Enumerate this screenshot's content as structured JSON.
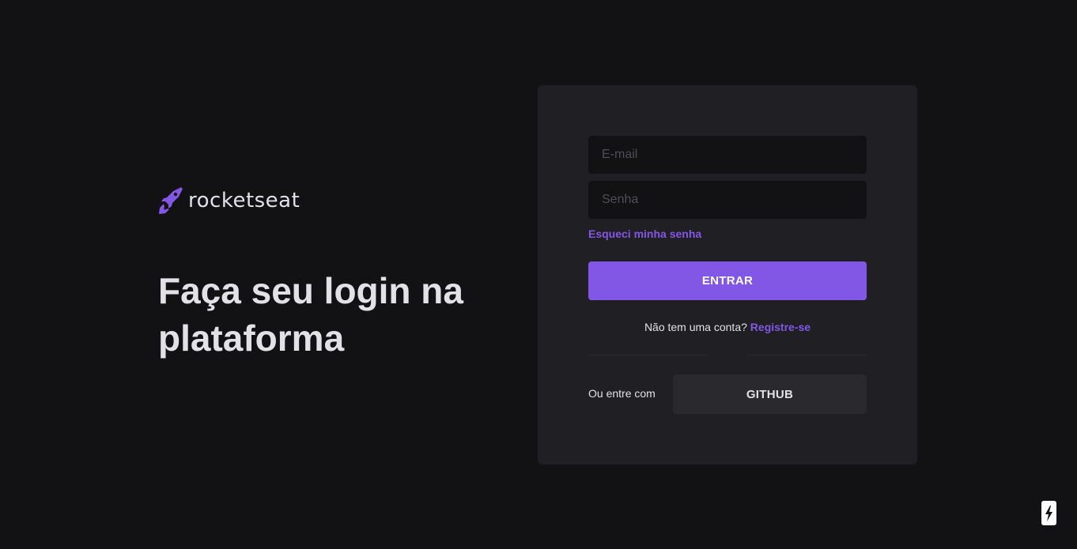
{
  "brand": {
    "name": "rocketseat",
    "accent_color": "#8257e5"
  },
  "hero": {
    "headline": "Faça seu login na plataforma"
  },
  "login_form": {
    "email_placeholder": "E-mail",
    "email_value": "",
    "password_placeholder": "Senha",
    "password_value": "",
    "forgot_password_label": "Esqueci minha senha",
    "submit_label": "ENTRAR",
    "no_account_text": "Não tem uma conta?",
    "register_label": "Registre-se",
    "alt_login_label": "Ou entre com",
    "github_label": "GITHUB"
  },
  "colors": {
    "background": "#121214",
    "card": "#202024",
    "input": "#121214",
    "primary": "#8257e5",
    "secondary_button": "#29292e",
    "text": "#e1e1e6"
  },
  "icons": {
    "brand_logo": "rocket-icon",
    "corner_badge": "lightning-icon"
  }
}
